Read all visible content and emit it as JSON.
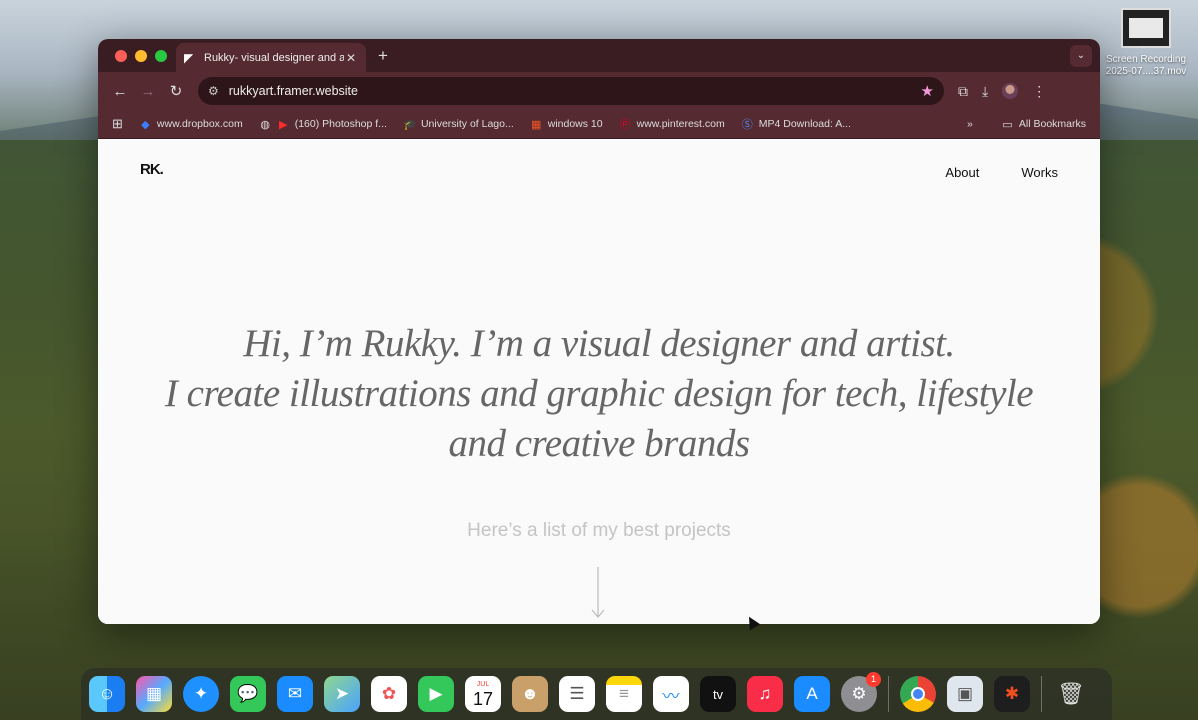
{
  "desktop": {
    "file": {
      "name_line1": "Screen Recording",
      "name_line2": "2025-07....37.mov"
    }
  },
  "browser": {
    "tab": {
      "title": "Rukky- visual designer and a",
      "favicon": "framer-icon"
    },
    "url": "rukkyart.framer.website",
    "bookmarks": [
      {
        "label": "www.dropbox.com",
        "icon": "dropbox-icon"
      },
      {
        "label": "(160) Photoshop f...",
        "icon": "youtube-icon"
      },
      {
        "label": "University of Lago...",
        "icon": "graduation-cap-icon"
      },
      {
        "label": "windows 10",
        "icon": "windows-icon"
      },
      {
        "label": "www.pinterest.com",
        "icon": "pinterest-icon"
      },
      {
        "label": "MP4 Download: A...",
        "icon": "s-icon"
      }
    ],
    "all_bookmarks": "All Bookmarks",
    "overflow": "»"
  },
  "page": {
    "logo": "RK.",
    "nav": [
      "About",
      "Works"
    ],
    "hero_line1": "Hi, I’m Rukky. I’m a visual designer and artist.",
    "hero_line2": "I create illustrations and graphic design for tech, lifestyle",
    "hero_line3": "and creative brands",
    "subtitle": "Here’s a list of my best projects"
  },
  "dock": {
    "calendar": {
      "month": "JUL",
      "day": "17"
    },
    "settings_badge": "1",
    "appletv_label": "tv"
  }
}
